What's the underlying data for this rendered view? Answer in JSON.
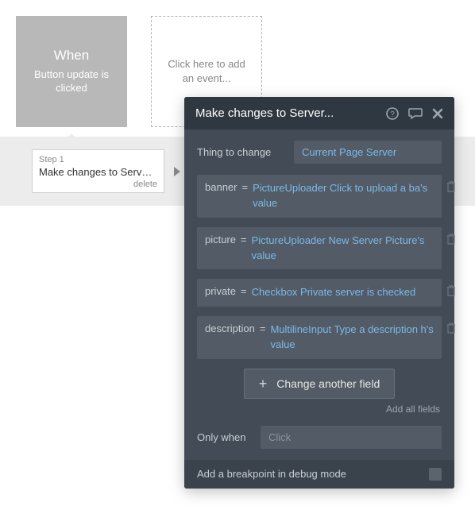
{
  "events": {
    "when": {
      "title": "When",
      "text": "Button update is clicked"
    },
    "add": {
      "text": "Click here to add an event..."
    }
  },
  "step": {
    "num": "Step 1",
    "title": "Make changes to Server...",
    "delete": "delete"
  },
  "editor": {
    "title": "Make changes to Server...",
    "thing_label": "Thing to change",
    "thing_value": "Current Page Server",
    "fields": {
      "banner": {
        "name": "banner",
        "expr": "PictureUploader Click to upload a ba's value"
      },
      "picture": {
        "name": "picture",
        "expr": "PictureUploader New Server Picture's value"
      },
      "private": {
        "name": "private",
        "expr": "Checkbox Private server is checked"
      },
      "description": {
        "name": "description",
        "expr": "MultilineInput Type a description h's value"
      }
    },
    "eq": "=",
    "change_another": "Change another field",
    "add_all": "Add all fields",
    "only_when_label": "Only when",
    "only_when_placeholder": "Click",
    "breakpoint": "Add a breakpoint in debug mode"
  }
}
